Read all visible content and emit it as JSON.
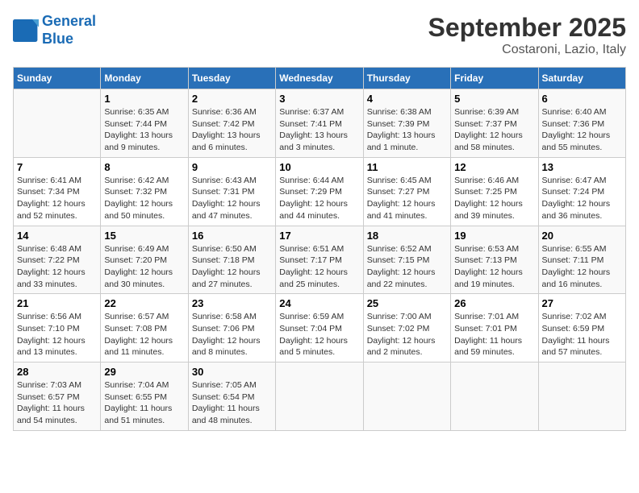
{
  "header": {
    "logo_line1": "General",
    "logo_line2": "Blue",
    "month": "September 2025",
    "location": "Costaroni, Lazio, Italy"
  },
  "weekdays": [
    "Sunday",
    "Monday",
    "Tuesday",
    "Wednesday",
    "Thursday",
    "Friday",
    "Saturday"
  ],
  "weeks": [
    [
      {
        "day": "",
        "info": ""
      },
      {
        "day": "1",
        "info": "Sunrise: 6:35 AM\nSunset: 7:44 PM\nDaylight: 13 hours\nand 9 minutes."
      },
      {
        "day": "2",
        "info": "Sunrise: 6:36 AM\nSunset: 7:42 PM\nDaylight: 13 hours\nand 6 minutes."
      },
      {
        "day": "3",
        "info": "Sunrise: 6:37 AM\nSunset: 7:41 PM\nDaylight: 13 hours\nand 3 minutes."
      },
      {
        "day": "4",
        "info": "Sunrise: 6:38 AM\nSunset: 7:39 PM\nDaylight: 13 hours\nand 1 minute."
      },
      {
        "day": "5",
        "info": "Sunrise: 6:39 AM\nSunset: 7:37 PM\nDaylight: 12 hours\nand 58 minutes."
      },
      {
        "day": "6",
        "info": "Sunrise: 6:40 AM\nSunset: 7:36 PM\nDaylight: 12 hours\nand 55 minutes."
      }
    ],
    [
      {
        "day": "7",
        "info": "Sunrise: 6:41 AM\nSunset: 7:34 PM\nDaylight: 12 hours\nand 52 minutes."
      },
      {
        "day": "8",
        "info": "Sunrise: 6:42 AM\nSunset: 7:32 PM\nDaylight: 12 hours\nand 50 minutes."
      },
      {
        "day": "9",
        "info": "Sunrise: 6:43 AM\nSunset: 7:31 PM\nDaylight: 12 hours\nand 47 minutes."
      },
      {
        "day": "10",
        "info": "Sunrise: 6:44 AM\nSunset: 7:29 PM\nDaylight: 12 hours\nand 44 minutes."
      },
      {
        "day": "11",
        "info": "Sunrise: 6:45 AM\nSunset: 7:27 PM\nDaylight: 12 hours\nand 41 minutes."
      },
      {
        "day": "12",
        "info": "Sunrise: 6:46 AM\nSunset: 7:25 PM\nDaylight: 12 hours\nand 39 minutes."
      },
      {
        "day": "13",
        "info": "Sunrise: 6:47 AM\nSunset: 7:24 PM\nDaylight: 12 hours\nand 36 minutes."
      }
    ],
    [
      {
        "day": "14",
        "info": "Sunrise: 6:48 AM\nSunset: 7:22 PM\nDaylight: 12 hours\nand 33 minutes."
      },
      {
        "day": "15",
        "info": "Sunrise: 6:49 AM\nSunset: 7:20 PM\nDaylight: 12 hours\nand 30 minutes."
      },
      {
        "day": "16",
        "info": "Sunrise: 6:50 AM\nSunset: 7:18 PM\nDaylight: 12 hours\nand 27 minutes."
      },
      {
        "day": "17",
        "info": "Sunrise: 6:51 AM\nSunset: 7:17 PM\nDaylight: 12 hours\nand 25 minutes."
      },
      {
        "day": "18",
        "info": "Sunrise: 6:52 AM\nSunset: 7:15 PM\nDaylight: 12 hours\nand 22 minutes."
      },
      {
        "day": "19",
        "info": "Sunrise: 6:53 AM\nSunset: 7:13 PM\nDaylight: 12 hours\nand 19 minutes."
      },
      {
        "day": "20",
        "info": "Sunrise: 6:55 AM\nSunset: 7:11 PM\nDaylight: 12 hours\nand 16 minutes."
      }
    ],
    [
      {
        "day": "21",
        "info": "Sunrise: 6:56 AM\nSunset: 7:10 PM\nDaylight: 12 hours\nand 13 minutes."
      },
      {
        "day": "22",
        "info": "Sunrise: 6:57 AM\nSunset: 7:08 PM\nDaylight: 12 hours\nand 11 minutes."
      },
      {
        "day": "23",
        "info": "Sunrise: 6:58 AM\nSunset: 7:06 PM\nDaylight: 12 hours\nand 8 minutes."
      },
      {
        "day": "24",
        "info": "Sunrise: 6:59 AM\nSunset: 7:04 PM\nDaylight: 12 hours\nand 5 minutes."
      },
      {
        "day": "25",
        "info": "Sunrise: 7:00 AM\nSunset: 7:02 PM\nDaylight: 12 hours\nand 2 minutes."
      },
      {
        "day": "26",
        "info": "Sunrise: 7:01 AM\nSunset: 7:01 PM\nDaylight: 11 hours\nand 59 minutes."
      },
      {
        "day": "27",
        "info": "Sunrise: 7:02 AM\nSunset: 6:59 PM\nDaylight: 11 hours\nand 57 minutes."
      }
    ],
    [
      {
        "day": "28",
        "info": "Sunrise: 7:03 AM\nSunset: 6:57 PM\nDaylight: 11 hours\nand 54 minutes."
      },
      {
        "day": "29",
        "info": "Sunrise: 7:04 AM\nSunset: 6:55 PM\nDaylight: 11 hours\nand 51 minutes."
      },
      {
        "day": "30",
        "info": "Sunrise: 7:05 AM\nSunset: 6:54 PM\nDaylight: 11 hours\nand 48 minutes."
      },
      {
        "day": "",
        "info": ""
      },
      {
        "day": "",
        "info": ""
      },
      {
        "day": "",
        "info": ""
      },
      {
        "day": "",
        "info": ""
      }
    ]
  ]
}
